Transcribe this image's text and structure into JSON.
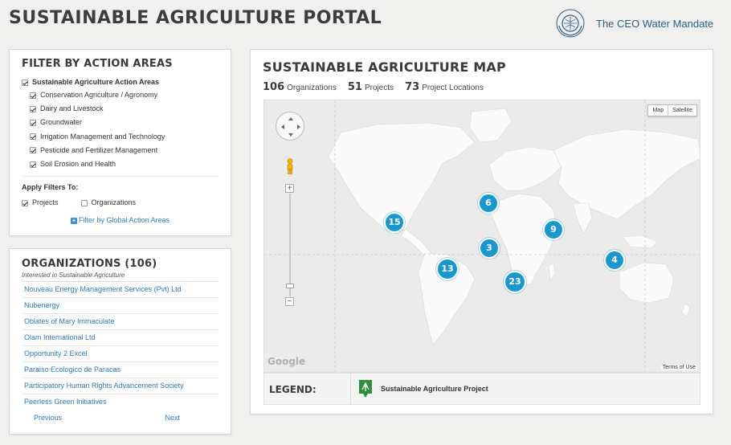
{
  "header": {
    "title": "SUSTAINABLE AGRICULTURE PORTAL",
    "logo_text": "The CEO Water Mandate"
  },
  "filter": {
    "title": "FILTER BY ACTION AREAS",
    "root_label": "Sustainable Agriculture Action Areas",
    "root_checked": true,
    "items": [
      {
        "label": "Conservation Agriculture / Agronomy",
        "checked": true
      },
      {
        "label": "Dairy and Livestock",
        "checked": true
      },
      {
        "label": "Groundwater",
        "checked": true
      },
      {
        "label": "Irrigation Management and Technology",
        "checked": true
      },
      {
        "label": "Pesticide and Fertilizer Management",
        "checked": true
      },
      {
        "label": "Soil Erosion and Health",
        "checked": true
      }
    ],
    "apply_label": "Apply Filters To:",
    "apply_options": [
      {
        "label": "Projects",
        "checked": true
      },
      {
        "label": "Organizations",
        "checked": false
      }
    ],
    "global_link": "Filter by Global Action Areas"
  },
  "orgs": {
    "title": "ORGANIZATIONS (106)",
    "subtitle": "Interested in Sustainable Agriculture",
    "items": [
      "Nouveau Energy Management Services (Pvt) Ltd",
      "Nubenergy",
      "Oblates of Mary Immaculate",
      "Olam International Ltd",
      "Opportunity 2 Excel",
      "Paraiso Ecologico de Paracas",
      "Participatory Human Rights Advancement Society",
      "Peerless Green Initiatives"
    ],
    "prev_label": "Previous",
    "next_label": "Next"
  },
  "map": {
    "title": "SUSTAINABLE AGRICULTURE MAP",
    "stats": [
      {
        "value": "106",
        "label": "Organizations"
      },
      {
        "value": "51",
        "label": "Projects"
      },
      {
        "value": "73",
        "label": "Project Locations"
      }
    ],
    "map_type_buttons": [
      "Map",
      "Satellite"
    ],
    "google_label": "Google",
    "terms_label": "Terms of Use",
    "clusters": [
      {
        "count": "15",
        "region": "north-america"
      },
      {
        "count": "6",
        "region": "europe"
      },
      {
        "count": "9",
        "region": "south-asia"
      },
      {
        "count": "3",
        "region": "central-africa"
      },
      {
        "count": "13",
        "region": "south-america"
      },
      {
        "count": "23",
        "region": "southern-africa"
      },
      {
        "count": "4",
        "region": "australia"
      }
    ],
    "cluster_color": "#1b97cf",
    "legend_title": "LEGEND:",
    "legend_item": "Sustainable Agriculture Project",
    "legend_icon_color": "#2f8f3a"
  }
}
